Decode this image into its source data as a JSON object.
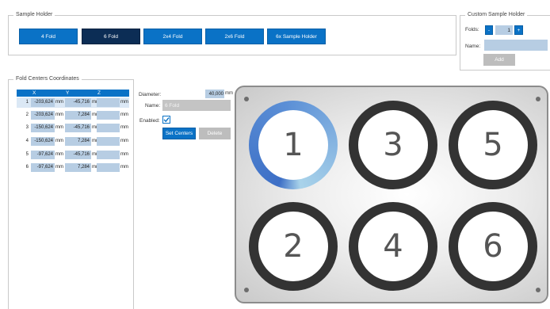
{
  "sample_holder": {
    "title": "Sample Holder",
    "buttons": [
      {
        "label": "4 Fold",
        "active": false
      },
      {
        "label": "6 Fold",
        "active": true
      },
      {
        "label": "2x4 Fold",
        "active": false
      },
      {
        "label": "2x6 Fold",
        "active": false
      },
      {
        "label": "6x Sample Holder",
        "active": false
      }
    ]
  },
  "custom_holder": {
    "title": "Custom Sample Holder",
    "folds_label": "Folds:",
    "minus": "-",
    "folds_value": "1",
    "plus": "+",
    "name_label": "Name:",
    "name_value": "",
    "add_label": "Add"
  },
  "fold_centers": {
    "title": "Fold Centers Coordinates",
    "columns": [
      "X",
      "Y",
      "Z"
    ],
    "unit": "mm",
    "rows": [
      {
        "idx": "1",
        "x": "-203,624",
        "y": "-45,716",
        "z": ""
      },
      {
        "idx": "2",
        "x": "-203,624",
        "y": "7,284",
        "z": ""
      },
      {
        "idx": "3",
        "x": "-150,624",
        "y": "-45,716",
        "z": ""
      },
      {
        "idx": "4",
        "x": "-150,624",
        "y": "7,284",
        "z": ""
      },
      {
        "idx": "5",
        "x": "-97,624",
        "y": "-45,716",
        "z": ""
      },
      {
        "idx": "6",
        "x": "-97,624",
        "y": "7,284",
        "z": ""
      }
    ]
  },
  "details": {
    "diameter_label": "Diameter:",
    "diameter_value": "40,000",
    "diameter_unit": "mm",
    "name_label": "Name:",
    "name_value": "6 Fold",
    "enabled_label": "Enabled:",
    "enabled": true,
    "set_centers_label": "Set Centers",
    "delete_label": "Delete"
  },
  "plate": {
    "folds": [
      "1",
      "3",
      "5",
      "2",
      "4",
      "6"
    ],
    "selected": "1"
  },
  "colors": {
    "accent": "#0a72c6",
    "active_button": "#0c2d55",
    "field": "#b7cde3",
    "ring": "#333333"
  }
}
